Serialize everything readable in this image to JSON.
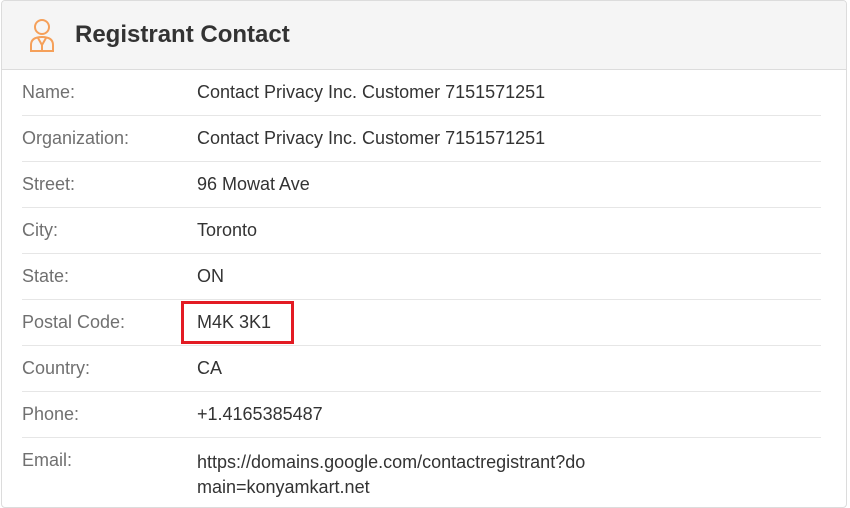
{
  "header": {
    "title": "Registrant Contact",
    "icon": "user-contact-icon",
    "icon_color": "#f5a05a"
  },
  "fields": [
    {
      "label": "Name:",
      "value": "Contact Privacy Inc. Customer 7151571251"
    },
    {
      "label": "Organization:",
      "value": "Contact Privacy Inc. Customer 7151571251"
    },
    {
      "label": "Street:",
      "value": "96 Mowat Ave"
    },
    {
      "label": "City:",
      "value": "Toronto"
    },
    {
      "label": "State:",
      "value": "ON"
    },
    {
      "label": "Postal Code:",
      "value": "M4K 3K1"
    },
    {
      "label": "Country:",
      "value": "CA"
    },
    {
      "label": "Phone:",
      "value": "+1.4165385487"
    },
    {
      "label": "Email:",
      "value": "https://domains.google.com/contactregistrant?domain=konyamkart.net"
    }
  ],
  "highlight_color": "#e31b23"
}
